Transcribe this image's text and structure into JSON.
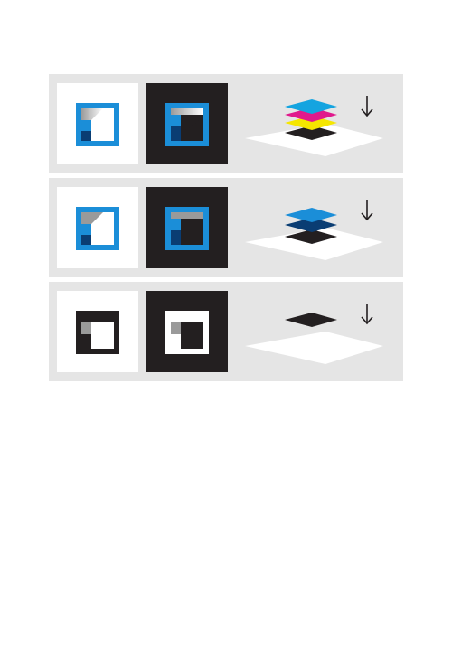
{
  "colors": {
    "panel_bg": "#e5e5e5",
    "light_tile": "#ffffff",
    "dark_tile": "#231f20",
    "blue": "#1b8ed8",
    "dark_blue": "#0a3d73",
    "cyan": "#14a4e0",
    "magenta": "#e0198c",
    "yellow": "#f5e600",
    "black": "#231f20",
    "gray": "#9a9a9a",
    "white": "#ffffff"
  },
  "rows": [
    {
      "variant": "full-color",
      "inks": [
        "cyan",
        "magenta",
        "yellow",
        "black"
      ],
      "arrow_icon": "down-arrow-icon"
    },
    {
      "variant": "two-spot-color",
      "inks": [
        "blue",
        "dark-blue",
        "black"
      ],
      "arrow_icon": "down-arrow-icon"
    },
    {
      "variant": "one-color",
      "inks": [
        "black"
      ],
      "arrow_icon": "down-arrow-icon"
    }
  ]
}
